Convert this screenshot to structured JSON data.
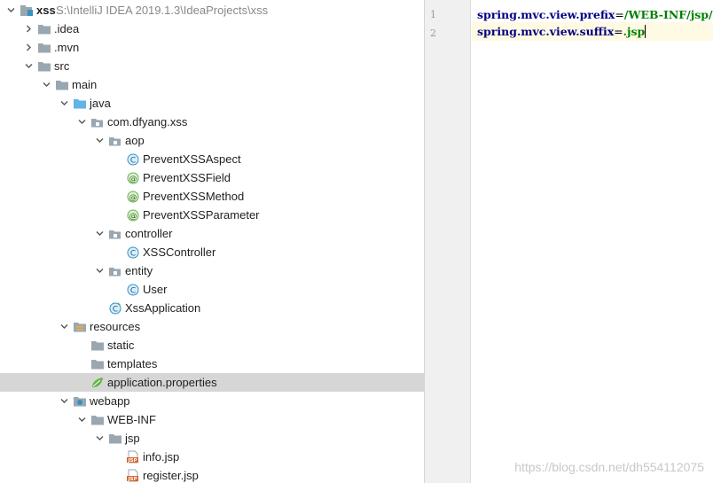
{
  "tree": [
    {
      "label": "xss",
      "path": "S:\\IntelliJ IDEA 2019.1.3\\IdeaProjects\\xss",
      "level": 0,
      "arrow": "down",
      "icon": "module",
      "bold": true
    },
    {
      "label": ".idea",
      "level": 1,
      "arrow": "right",
      "icon": "folder"
    },
    {
      "label": ".mvn",
      "level": 1,
      "arrow": "right",
      "icon": "folder"
    },
    {
      "label": "src",
      "level": 1,
      "arrow": "down",
      "icon": "folder"
    },
    {
      "label": "main",
      "level": 2,
      "arrow": "down",
      "icon": "folder"
    },
    {
      "label": "java",
      "level": 3,
      "arrow": "down",
      "icon": "source-folder"
    },
    {
      "label": "com.dfyang.xss",
      "level": 4,
      "arrow": "down",
      "icon": "package"
    },
    {
      "label": "aop",
      "level": 5,
      "arrow": "down",
      "icon": "package"
    },
    {
      "label": "PreventXSSAspect",
      "level": 6,
      "icon": "class"
    },
    {
      "label": "PreventXSSField",
      "level": 6,
      "icon": "annotation"
    },
    {
      "label": "PreventXSSMethod",
      "level": 6,
      "icon": "annotation"
    },
    {
      "label": "PreventXSSParameter",
      "level": 6,
      "icon": "annotation"
    },
    {
      "label": "controller",
      "level": 5,
      "arrow": "down",
      "icon": "package"
    },
    {
      "label": "XSSController",
      "level": 6,
      "icon": "class"
    },
    {
      "label": "entity",
      "level": 5,
      "arrow": "down",
      "icon": "package"
    },
    {
      "label": "User",
      "level": 6,
      "icon": "class"
    },
    {
      "label": "XssApplication",
      "level": 5,
      "icon": "spring-class"
    },
    {
      "label": "resources",
      "level": 3,
      "arrow": "down",
      "icon": "resources-folder"
    },
    {
      "label": "static",
      "level": 4,
      "icon": "folder"
    },
    {
      "label": "templates",
      "level": 4,
      "icon": "folder"
    },
    {
      "label": "application.properties",
      "level": 4,
      "icon": "properties",
      "selected": true
    },
    {
      "label": "webapp",
      "level": 3,
      "arrow": "down",
      "icon": "web-folder"
    },
    {
      "label": "WEB-INF",
      "level": 4,
      "arrow": "down",
      "icon": "folder"
    },
    {
      "label": "jsp",
      "level": 5,
      "arrow": "down",
      "icon": "folder"
    },
    {
      "label": "info.jsp",
      "level": 6,
      "icon": "jsp"
    },
    {
      "label": "register.jsp",
      "level": 6,
      "icon": "jsp"
    }
  ],
  "editor": {
    "lines": [
      {
        "num": "1",
        "key": "spring.mvc.view.prefix",
        "eq": "=",
        "value": "/WEB-INF/jsp/"
      },
      {
        "num": "2",
        "key": "spring.mvc.view.suffix",
        "eq": "=",
        "value": ".jsp",
        "current": true
      }
    ]
  },
  "watermark": "https://blog.csdn.net/dh554112075"
}
